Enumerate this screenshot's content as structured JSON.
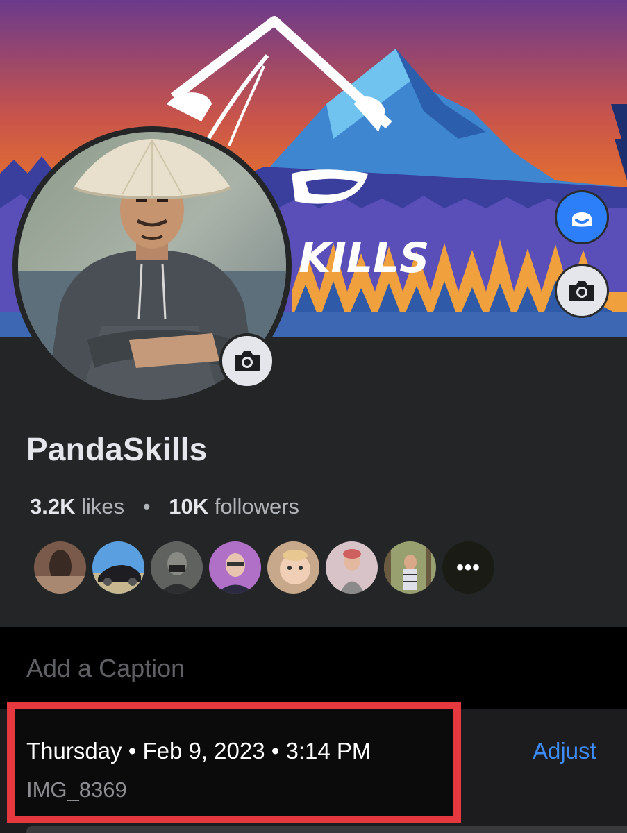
{
  "page": {
    "name": "PandaSkills",
    "likes_count": "3.2K",
    "likes_label": "likes",
    "separator": "•",
    "followers_count": "10K",
    "followers_label": "followers",
    "cover_text": "KILLS"
  },
  "friends": {
    "more_label": "•••"
  },
  "photo_info": {
    "caption_placeholder": "Add a Caption",
    "date_line": "Thursday • Feb 9, 2023 • 3:14 PM",
    "filename": "IMG_8369",
    "adjust_label": "Adjust"
  },
  "colors": {
    "accent_blue": "#3d8bf7",
    "highlight_red": "#e5383f",
    "panel_dark": "#242526"
  },
  "icons": {
    "cover_avatar": "avatar-icon",
    "cover_camera": "camera-icon",
    "profile_camera": "camera-icon",
    "more": "more-dots-icon"
  }
}
